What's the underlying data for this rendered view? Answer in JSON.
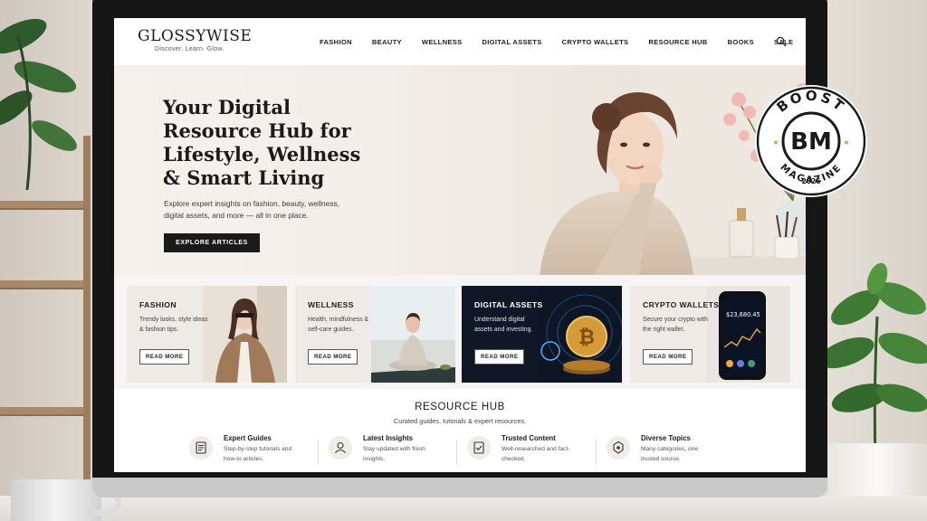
{
  "site": {
    "logo": "GLOSSYWISE",
    "tagline": "Discover. Learn. Glow."
  },
  "nav": [
    "FASHION",
    "BEAUTY",
    "WELLNESS",
    "DIGITAL ASSETS",
    "CRYPTO WALLETS",
    "RESOURCE HUB",
    "BOOKS",
    "SALE"
  ],
  "hero": {
    "title": "Your Digital Resource Hub for Lifestyle, Wellness & Smart Living",
    "text": "Explore expert insights on fashion, beauty, wellness, digital assets, and more — all in one place.",
    "cta": "EXPLORE ARTICLES"
  },
  "cards": [
    {
      "title": "FASHION",
      "desc": "Trendy looks, style ideas & fashion tips.",
      "button": "READ MORE"
    },
    {
      "title": "WELLNESS",
      "desc": "Health, mindfulness & self-care guides.",
      "button": "READ MORE"
    },
    {
      "title": "DIGITAL ASSETS",
      "desc": "Understand digital assets and investing.",
      "button": "READ MORE"
    },
    {
      "title": "CRYPTO WALLETS",
      "desc": "Secure your crypto with the right wallet.",
      "button": "READ MORE",
      "phone_balance": "$23,680.45"
    }
  ],
  "hub": {
    "title": "RESOURCE HUB",
    "subtitle": "Curated guides, tutorials & expert resources.",
    "items": [
      {
        "title": "Expert Guides",
        "desc": "Step-by-step tutorials and how-to articles.",
        "icon": "guide-icon"
      },
      {
        "title": "Latest Insights",
        "desc": "Stay updated with fresh insights.",
        "icon": "insights-icon"
      },
      {
        "title": "Trusted Content",
        "desc": "Well-researched and fact-checked.",
        "icon": "trusted-icon"
      },
      {
        "title": "Diverse Topics",
        "desc": "Many categories, one trusted source.",
        "icon": "topics-icon"
      }
    ]
  },
  "badge": {
    "top": "BOOST",
    "mark": "BM",
    "bottom": "MAGAZINE",
    "year": "2026"
  },
  "colors": {
    "accent": "#1a1a1a",
    "hero_bg": "#f3efea",
    "card_bg": "#eeebe7",
    "dark_card": "#101828",
    "gold": "#c8963e"
  }
}
